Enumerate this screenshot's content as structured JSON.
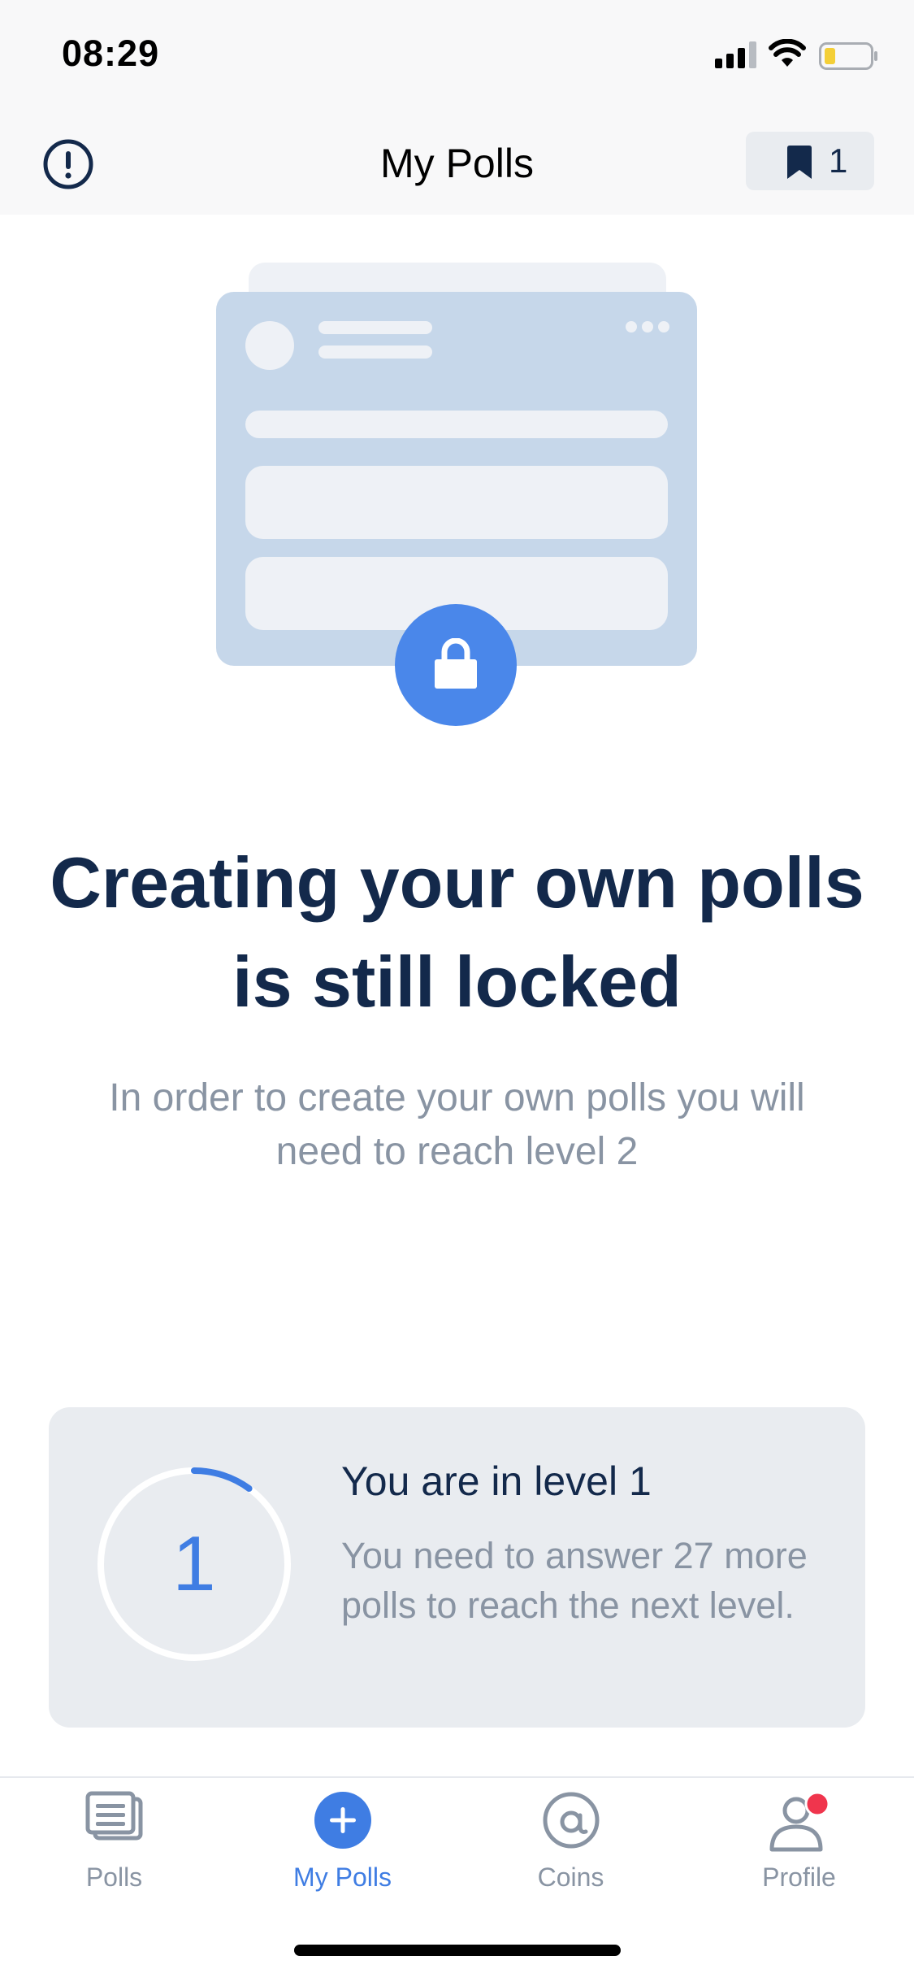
{
  "status_bar": {
    "time": "08:29",
    "icons": [
      "signal-icon",
      "wifi-icon",
      "battery-icon"
    ]
  },
  "header": {
    "title": "My Polls",
    "info_icon": "info-icon",
    "bookmark": {
      "icon": "bookmark-icon",
      "count": "1"
    }
  },
  "illustration": {
    "icon": "lock-icon",
    "accent_color": "#4a87ea",
    "card_color": "#c6d7ea"
  },
  "main": {
    "headline": "Creating your own polls is still locked",
    "subtext": "In order to create your own polls you will need to reach level 2"
  },
  "level": {
    "number": "1",
    "title": "You are in level 1",
    "description": "You need to answer 27 more polls to reach the next level.",
    "progress": 0.1,
    "progress_color": "#3f7de3"
  },
  "tabs": [
    {
      "label": "Polls",
      "icon": "polls-icon",
      "active": false
    },
    {
      "label": "My Polls",
      "icon": "plus-circle-icon",
      "active": true
    },
    {
      "label": "Coins",
      "icon": "coins-icon",
      "active": false
    },
    {
      "label": "Profile",
      "icon": "profile-icon",
      "active": false,
      "badge_color": "#f0354d"
    }
  ],
  "colors": {
    "primary": "#13294b",
    "accent": "#3f7de3",
    "muted": "#8994a3",
    "surface": "#e9ecf0"
  }
}
